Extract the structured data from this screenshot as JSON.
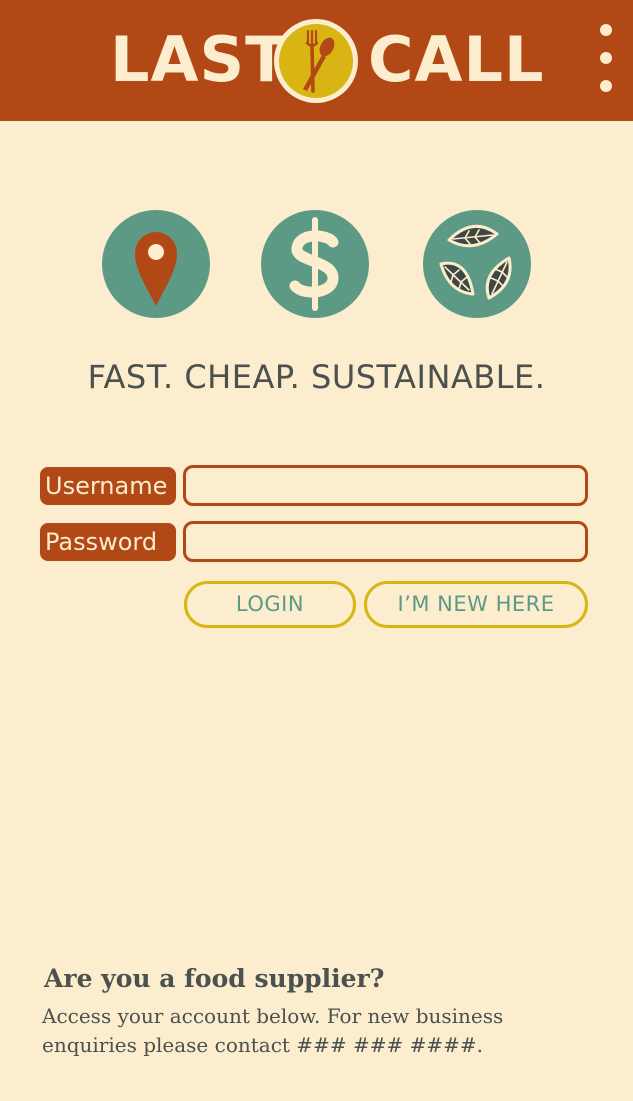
{
  "header": {
    "logo_left": "LAST",
    "logo_right": "CALL",
    "menu_icon": "more-vertical-icon",
    "background": "#b24815"
  },
  "features": [
    {
      "icon": "location-pin-icon"
    },
    {
      "icon": "dollar-sign-icon"
    },
    {
      "icon": "leaves-icon"
    }
  ],
  "tagline": "FAST. CHEAP. SUSTAINABLE.",
  "login_form": {
    "username_label": "Username",
    "username_value": "",
    "password_label": "Password",
    "password_value": "",
    "login_label": "LOGIN",
    "register_label": "I’M NEW HERE"
  },
  "supplier": {
    "heading": "Are you a food supplier?",
    "body": "Access your account below. For new business enquiries please contact ### ### ####."
  },
  "colors": {
    "background": "#fbedcd",
    "brand_rust": "#b24815",
    "accent_green": "#5c9a86",
    "accent_yellow": "#d9b514",
    "text_dark": "#4a514e"
  }
}
